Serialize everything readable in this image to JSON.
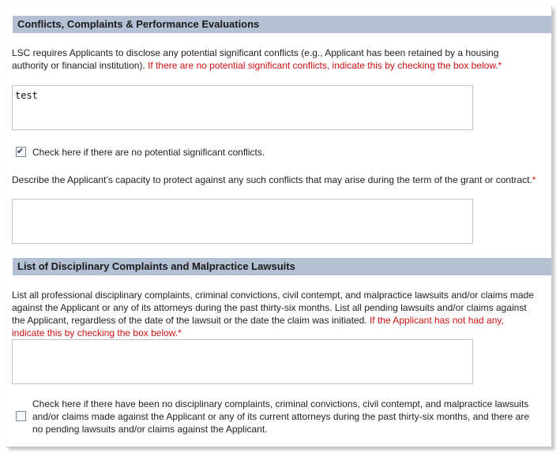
{
  "section1": {
    "header": "Conflicts, Complaints & Performance Evaluations",
    "intro": "LSC requires Applicants to disclose any potential significant conflicts (e.g., Applicant has been retained by a housing authority or financial institution).",
    "intro_required": "If there are no potential significant conflicts, indicate this by checking the box below.*",
    "conflicts_value": "test",
    "no_conflicts_checkbox_label": "Check here if there are no potential significant conflicts.",
    "no_conflicts_checked": true,
    "capacity_question": "Describe the Applicant’s capacity to protect against any such conflicts that may arise during the term of the grant or contract.",
    "capacity_required_mark": "*",
    "capacity_value": ""
  },
  "section2": {
    "header": "List of Disciplinary Complaints and Malpractice Lawsuits",
    "intro": "List all professional disciplinary complaints, criminal convictions, civil contempt, and malpractice lawsuits and/or claims made against the Applicant or any of its attorneys during the past thirty-six months. List all pending lawsuits and/or claims against the Applicant, regardless of the date of the lawsuit or the date the claim was initiated.",
    "intro_required": "If the Applicant has not had any, indicate this by checking the box below.*",
    "complaints_value": "",
    "no_complaints_checkbox_label": "Check here if there have been no disciplinary complaints, criminal convictions, civil contempt, and malpractice lawsuits and/or claims made against the Applicant or any of its current attorneys during the past thirty-six months, and there are no pending lawsuits and/or claims against the Applicant.",
    "no_complaints_checked": false
  }
}
